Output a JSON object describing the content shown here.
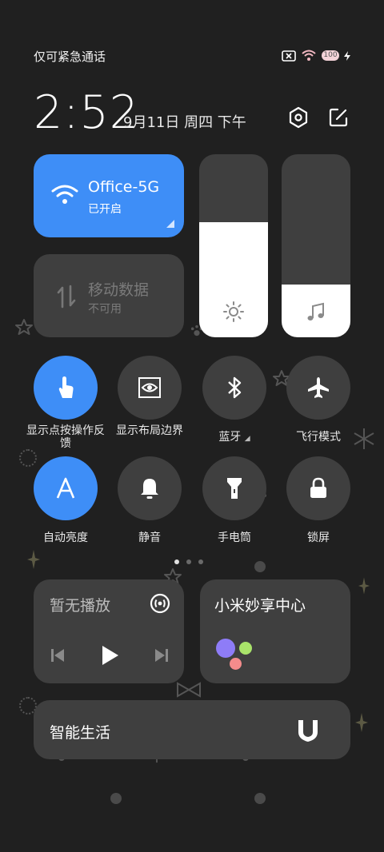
{
  "status_bar": {
    "carrier_text": "仅可紧急通话",
    "battery_level": "100"
  },
  "header": {
    "time": "2:52",
    "date": "9月11日 周四 下午"
  },
  "wifi_tile": {
    "title": "Office-5G",
    "status": "已开启",
    "active": true
  },
  "mobile_tile": {
    "title": "移动数据",
    "status": "不可用",
    "active": false
  },
  "sliders": {
    "brightness_level": 0.63,
    "volume_level": 0.29
  },
  "toggles": [
    {
      "label": "显示点按操作反馈",
      "active": true
    },
    {
      "label": "显示布局边界",
      "active": false
    },
    {
      "label": "蓝牙",
      "active": false
    },
    {
      "label": "飞行模式",
      "active": false
    },
    {
      "label": "自动亮度",
      "active": true
    },
    {
      "label": "静音",
      "active": false
    },
    {
      "label": "手电筒",
      "active": false
    },
    {
      "label": "锁屏",
      "active": false
    }
  ],
  "toggle_icons": [
    "touch-icon",
    "layout-bounds-icon",
    "bluetooth-icon",
    "airplane-icon",
    "auto-brightness-icon",
    "bell-icon",
    "flashlight-icon",
    "lock-icon"
  ],
  "page_indicator": {
    "current": 1,
    "total": 3
  },
  "media": {
    "title": "暂无播放"
  },
  "mi_share": {
    "title": "小米妙享中心"
  },
  "smart_life": {
    "title": "智能生活"
  },
  "colors": {
    "background": "#202020",
    "tile": "#3f3f3f",
    "accent": "#3e8ef7",
    "text": "#ffffff"
  }
}
